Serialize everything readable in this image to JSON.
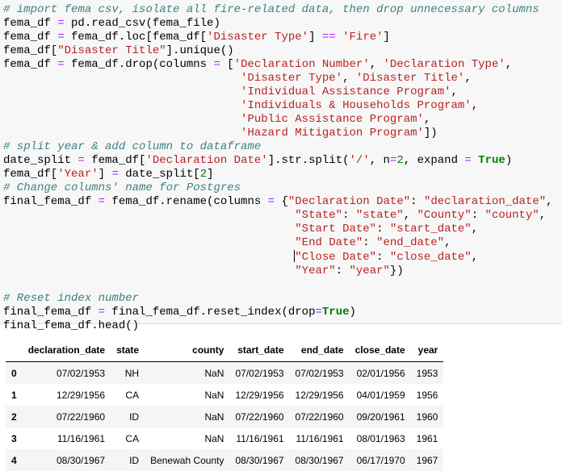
{
  "code_cell": {
    "lines": [
      [
        [
          "comment",
          "# import fema csv, isolate all fire-related data, then drop unnecessary columns"
        ]
      ],
      [
        [
          "p",
          "fema_df "
        ],
        [
          "op",
          "="
        ],
        [
          "p",
          " pd.read_csv(fema_file)"
        ]
      ],
      [
        [
          "p",
          "fema_df "
        ],
        [
          "op",
          "="
        ],
        [
          "p",
          " fema_df.loc[fema_df["
        ],
        [
          "str",
          "'Disaster Type'"
        ],
        [
          "p",
          "] "
        ],
        [
          "op",
          "=="
        ],
        [
          "p",
          " "
        ],
        [
          "str",
          "'Fire'"
        ],
        [
          "p",
          "]"
        ]
      ],
      [
        [
          "p",
          "fema_df["
        ],
        [
          "str",
          "\"Disaster Title\""
        ],
        [
          "p",
          "].unique()"
        ]
      ],
      [
        [
          "p",
          "fema_df "
        ],
        [
          "op",
          "="
        ],
        [
          "p",
          " fema_df.drop(columns "
        ],
        [
          "op",
          "="
        ],
        [
          "p",
          " ["
        ],
        [
          "str",
          "'Declaration Number'"
        ],
        [
          "p",
          ", "
        ],
        [
          "str",
          "'Declaration Type'"
        ],
        [
          "p",
          ","
        ]
      ],
      [
        [
          "p",
          "                                   "
        ],
        [
          "str",
          "'Disaster Type'"
        ],
        [
          "p",
          ", "
        ],
        [
          "str",
          "'Disaster Title'"
        ],
        [
          "p",
          ","
        ]
      ],
      [
        [
          "p",
          "                                   "
        ],
        [
          "str",
          "'Individual Assistance Program'"
        ],
        [
          "p",
          ","
        ]
      ],
      [
        [
          "p",
          "                                   "
        ],
        [
          "str",
          "'Individuals & Households Program'"
        ],
        [
          "p",
          ","
        ]
      ],
      [
        [
          "p",
          "                                   "
        ],
        [
          "str",
          "'Public Assistance Program'"
        ],
        [
          "p",
          ","
        ]
      ],
      [
        [
          "p",
          "                                   "
        ],
        [
          "str",
          "'Hazard Mitigation Program'"
        ],
        [
          "p",
          "])"
        ]
      ],
      [
        [
          "comment",
          "# split year & add column to dataframe"
        ]
      ],
      [
        [
          "p",
          "date_split "
        ],
        [
          "op",
          "="
        ],
        [
          "p",
          " fema_df["
        ],
        [
          "str",
          "'Declaration Date'"
        ],
        [
          "p",
          "].str.split("
        ],
        [
          "str",
          "'/'"
        ],
        [
          "p",
          ", n"
        ],
        [
          "op",
          "="
        ],
        [
          "num",
          "2"
        ],
        [
          "p",
          ", expand "
        ],
        [
          "op",
          "="
        ],
        [
          "p",
          " "
        ],
        [
          "bool",
          "True"
        ],
        [
          "p",
          ")"
        ]
      ],
      [
        [
          "p",
          "fema_df["
        ],
        [
          "str",
          "'Year'"
        ],
        [
          "p",
          "] "
        ],
        [
          "op",
          "="
        ],
        [
          "p",
          " date_split["
        ],
        [
          "num",
          "2"
        ],
        [
          "p",
          "]"
        ]
      ],
      [
        [
          "comment",
          "# Change columns' name for Postgres"
        ]
      ],
      [
        [
          "p",
          "final_fema_df "
        ],
        [
          "op",
          "="
        ],
        [
          "p",
          " fema_df.rename(columns "
        ],
        [
          "op",
          "="
        ],
        [
          "p",
          " {"
        ],
        [
          "str",
          "\"Declaration Date\""
        ],
        [
          "p",
          ": "
        ],
        [
          "str",
          "\"declaration_date\""
        ],
        [
          "p",
          ","
        ]
      ],
      [
        [
          "p",
          "                                           "
        ],
        [
          "str",
          "\"State\""
        ],
        [
          "p",
          ": "
        ],
        [
          "str",
          "\"state\""
        ],
        [
          "p",
          ", "
        ],
        [
          "str",
          "\"County\""
        ],
        [
          "p",
          ": "
        ],
        [
          "str",
          "\"county\""
        ],
        [
          "p",
          ","
        ]
      ],
      [
        [
          "p",
          "                                           "
        ],
        [
          "str",
          "\"Start Date\""
        ],
        [
          "p",
          ": "
        ],
        [
          "str",
          "\"start_date\""
        ],
        [
          "p",
          ","
        ]
      ],
      [
        [
          "p",
          "                                           "
        ],
        [
          "str",
          "\"End Date\""
        ],
        [
          "p",
          ": "
        ],
        [
          "str",
          "\"end_date\""
        ],
        [
          "p",
          ","
        ]
      ],
      [
        [
          "p",
          "                                           "
        ],
        [
          "cursor",
          ""
        ],
        [
          "str",
          "\"Close Date\""
        ],
        [
          "p",
          ": "
        ],
        [
          "str",
          "\"close_date\""
        ],
        [
          "p",
          ","
        ]
      ],
      [
        [
          "p",
          "                                           "
        ],
        [
          "str",
          "\"Year\""
        ],
        [
          "p",
          ": "
        ],
        [
          "str",
          "\"year\""
        ],
        [
          "p",
          "})"
        ]
      ],
      [
        [
          "p",
          ""
        ]
      ],
      [
        [
          "comment",
          "# Reset index number"
        ]
      ],
      [
        [
          "p",
          "final_fema_df "
        ],
        [
          "op",
          "="
        ],
        [
          "p",
          " final_fema_df.reset_index(drop"
        ],
        [
          "op",
          "="
        ],
        [
          "bool",
          "True"
        ],
        [
          "p",
          ")"
        ]
      ],
      [
        [
          "p",
          "final_fema_df.head()"
        ]
      ]
    ]
  },
  "output_table": {
    "columns": [
      "",
      "declaration_date",
      "state",
      "county",
      "start_date",
      "end_date",
      "close_date",
      "year"
    ],
    "rows": [
      [
        "0",
        "07/02/1953",
        "NH",
        "NaN",
        "07/02/1953",
        "07/02/1953",
        "02/01/1956",
        "1953"
      ],
      [
        "1",
        "12/29/1956",
        "CA",
        "NaN",
        "12/29/1956",
        "12/29/1956",
        "04/01/1959",
        "1956"
      ],
      [
        "2",
        "07/22/1960",
        "ID",
        "NaN",
        "07/22/1960",
        "07/22/1960",
        "09/20/1961",
        "1960"
      ],
      [
        "3",
        "11/16/1961",
        "CA",
        "NaN",
        "11/16/1961",
        "11/16/1961",
        "08/01/1963",
        "1961"
      ],
      [
        "4",
        "08/30/1967",
        "ID",
        "Benewah County",
        "08/30/1967",
        "08/30/1967",
        "06/17/1970",
        "1967"
      ]
    ]
  }
}
